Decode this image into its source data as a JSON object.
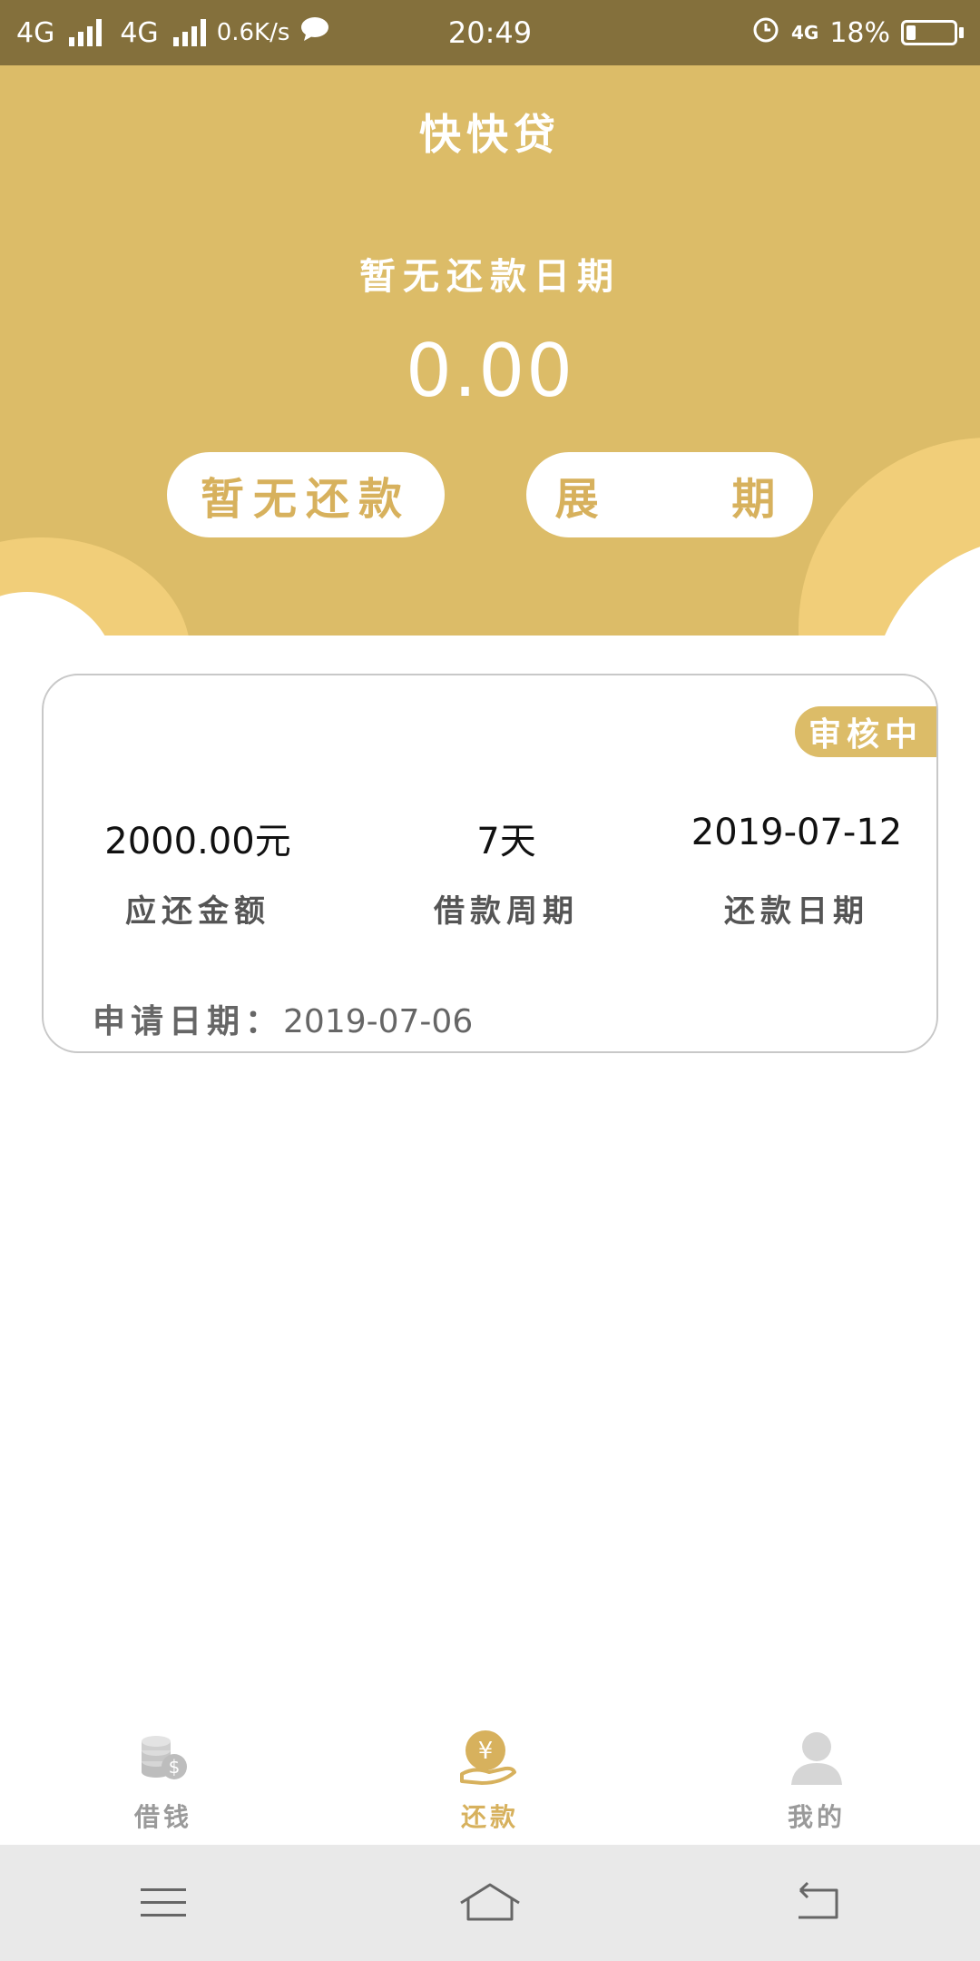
{
  "status_bar": {
    "network_1": "4G",
    "network_2": "4G",
    "speed": "0.6K/s",
    "time": "20:49",
    "network_right": "4G",
    "battery": "18%"
  },
  "header": {
    "app_title": "快快贷",
    "due_date_text": "暂无还款日期",
    "amount": "0.00",
    "btn_repay": "暂无还款",
    "btn_extend": "展 期"
  },
  "loan_card": {
    "status_badge": "审核中",
    "amount_value": "2000.00元",
    "amount_label": "应还金额",
    "period_value": "7天",
    "period_label": "借款周期",
    "repay_date_value": "2019-07-12",
    "repay_date_label": "还款日期",
    "apply_label": "申请日期：",
    "apply_date": "2019-07-06"
  },
  "bottom_nav": {
    "items": [
      {
        "label": "借钱",
        "icon": "coins-icon",
        "active": false
      },
      {
        "label": "还款",
        "icon": "yen-hand-icon",
        "active": true
      },
      {
        "label": "我的",
        "icon": "user-icon",
        "active": false
      }
    ]
  },
  "colors": {
    "status_bar_bg": "#84703c",
    "header_bg": "#dcbc68",
    "accent": "#d7b15d",
    "inactive": "#9a9a9a"
  }
}
